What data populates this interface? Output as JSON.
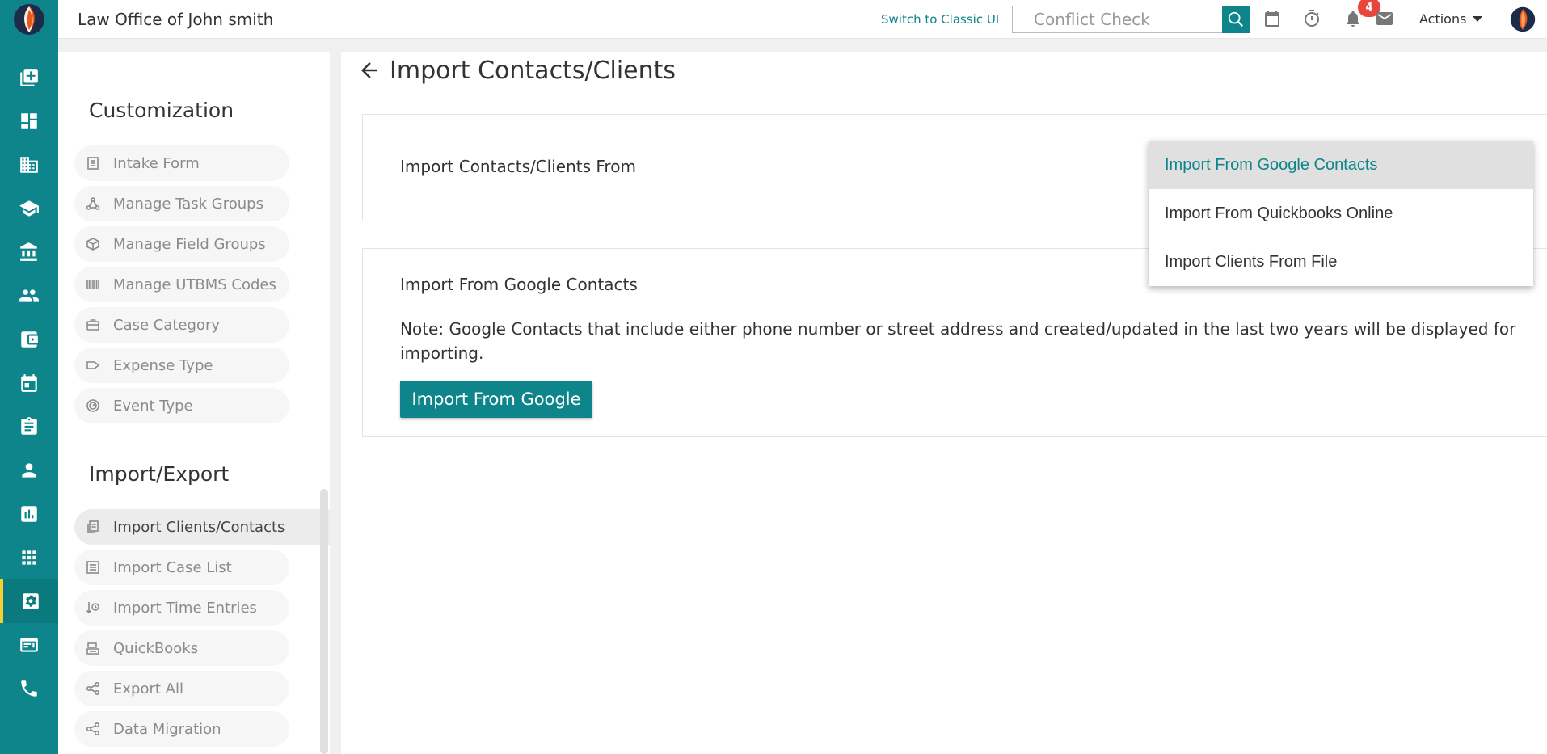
{
  "topbar": {
    "firm_name": "Law Office of John smith",
    "classic_link": "Switch to Classic UI",
    "conflict_placeholder": "Conflict Check",
    "notification_count": "4",
    "actions_label": "Actions"
  },
  "settings": {
    "customization_title": "Customization",
    "customization_items": [
      {
        "label": "Intake Form",
        "icon": "form-icon"
      },
      {
        "label": "Manage Task Groups",
        "icon": "task-groups-icon"
      },
      {
        "label": "Manage Field Groups",
        "icon": "cube-icon"
      },
      {
        "label": "Manage UTBMS Codes",
        "icon": "barcode-icon"
      },
      {
        "label": "Case Category",
        "icon": "briefcase-icon"
      },
      {
        "label": "Expense Type",
        "icon": "tag-icon"
      },
      {
        "label": "Event Type",
        "icon": "event-icon"
      }
    ],
    "import_export_title": "Import/Export",
    "import_export_items": [
      {
        "label": "Import Clients/Contacts",
        "icon": "documents-icon",
        "active": true
      },
      {
        "label": "Import Case List",
        "icon": "list-icon"
      },
      {
        "label": "Import Time Entries",
        "icon": "time-import-icon"
      },
      {
        "label": "QuickBooks",
        "icon": "register-icon"
      },
      {
        "label": "Export All",
        "icon": "share-icon"
      },
      {
        "label": "Data Migration",
        "icon": "share-icon"
      }
    ]
  },
  "main": {
    "page_title": "Import Contacts/Clients",
    "import_from_label": "Import Contacts/Clients From",
    "google_section_title": "Import From Google Contacts",
    "note": "Note: Google Contacts that include either phone number or street address and created/updated in the last two years will be displayed for importing.",
    "google_button": "Import From Google"
  },
  "dropdown": {
    "options": [
      "Import From Google Contacts",
      "Import From Quickbooks Online",
      "Import Clients From File"
    ],
    "selected": "Import From Google Contacts"
  },
  "colors": {
    "brand": "#0e858a",
    "badge": "#e8463a",
    "rail_active_indicator": "#f5d033"
  }
}
